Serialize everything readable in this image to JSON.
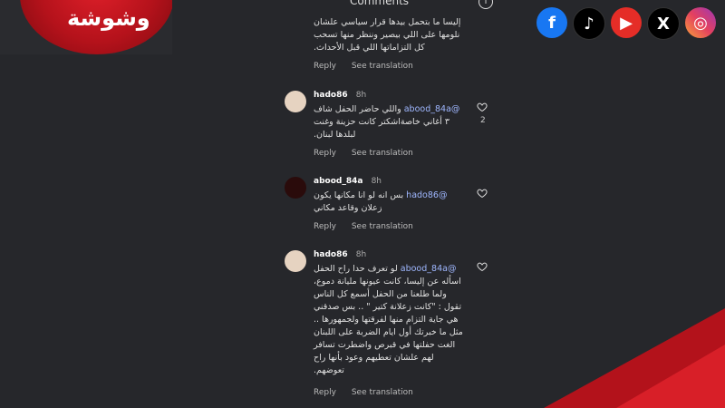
{
  "branding": {
    "logo_text": "وشوشة"
  },
  "social": [
    {
      "name": "facebook",
      "glyph": "f"
    },
    {
      "name": "tiktok",
      "glyph": "♪"
    },
    {
      "name": "youtube",
      "glyph": "▶"
    },
    {
      "name": "x",
      "glyph": "X"
    },
    {
      "name": "instagram",
      "glyph": "◎"
    }
  ],
  "header": {
    "title": "Comments"
  },
  "comments": [
    {
      "user": "",
      "time": "",
      "text": "إليسا ما بتحمل بيدها قرار سياسي علشان\nنلومها على اللي بيصير وننظر منها تسحب\nكل التزاماتها اللي قبل الأحداث.",
      "reply": "Reply",
      "translate": "See translation"
    },
    {
      "user": "hado86",
      "time": "8h",
      "mention": "@abood_84a",
      "text": "واللي حاضر الحفل شاف\n٣ أغاني خاصةاشكتر كانت حزينة وغنت\nلبلدها لبنان.",
      "likes": "2",
      "reply": "Reply",
      "translate": "See translation"
    },
    {
      "user": "abood_84a",
      "time": "8h",
      "mention": "@hado86",
      "text": "بس انه لو انا مكانها يكون\nزعلان وقاعد مكاني",
      "reply": "Reply",
      "translate": "See translation"
    },
    {
      "user": "hado86",
      "time": "8h",
      "mention": "@abood_84a",
      "text": "لو تعرف حدا راح الحفل\nاسأله عن إليسا، كانت عيونها مليانة دموع،\nولما طلعنا من الحفل أسمع كل الناس\nتقول : \"كانت زعلانة كتير \" .. بس صدقني\nهي جاية التزام منها لفرقتها ولجمهورها ..\nمثل ما خبرتك أول ايام الضربة على اللبنان\nالغت حفلتها في قبرص واضطرت تسافر\nلهم علشان تعطيهم وعود بأنها راح\nتعوضهم.",
      "reply": "Reply",
      "translate": "See translation"
    }
  ]
}
